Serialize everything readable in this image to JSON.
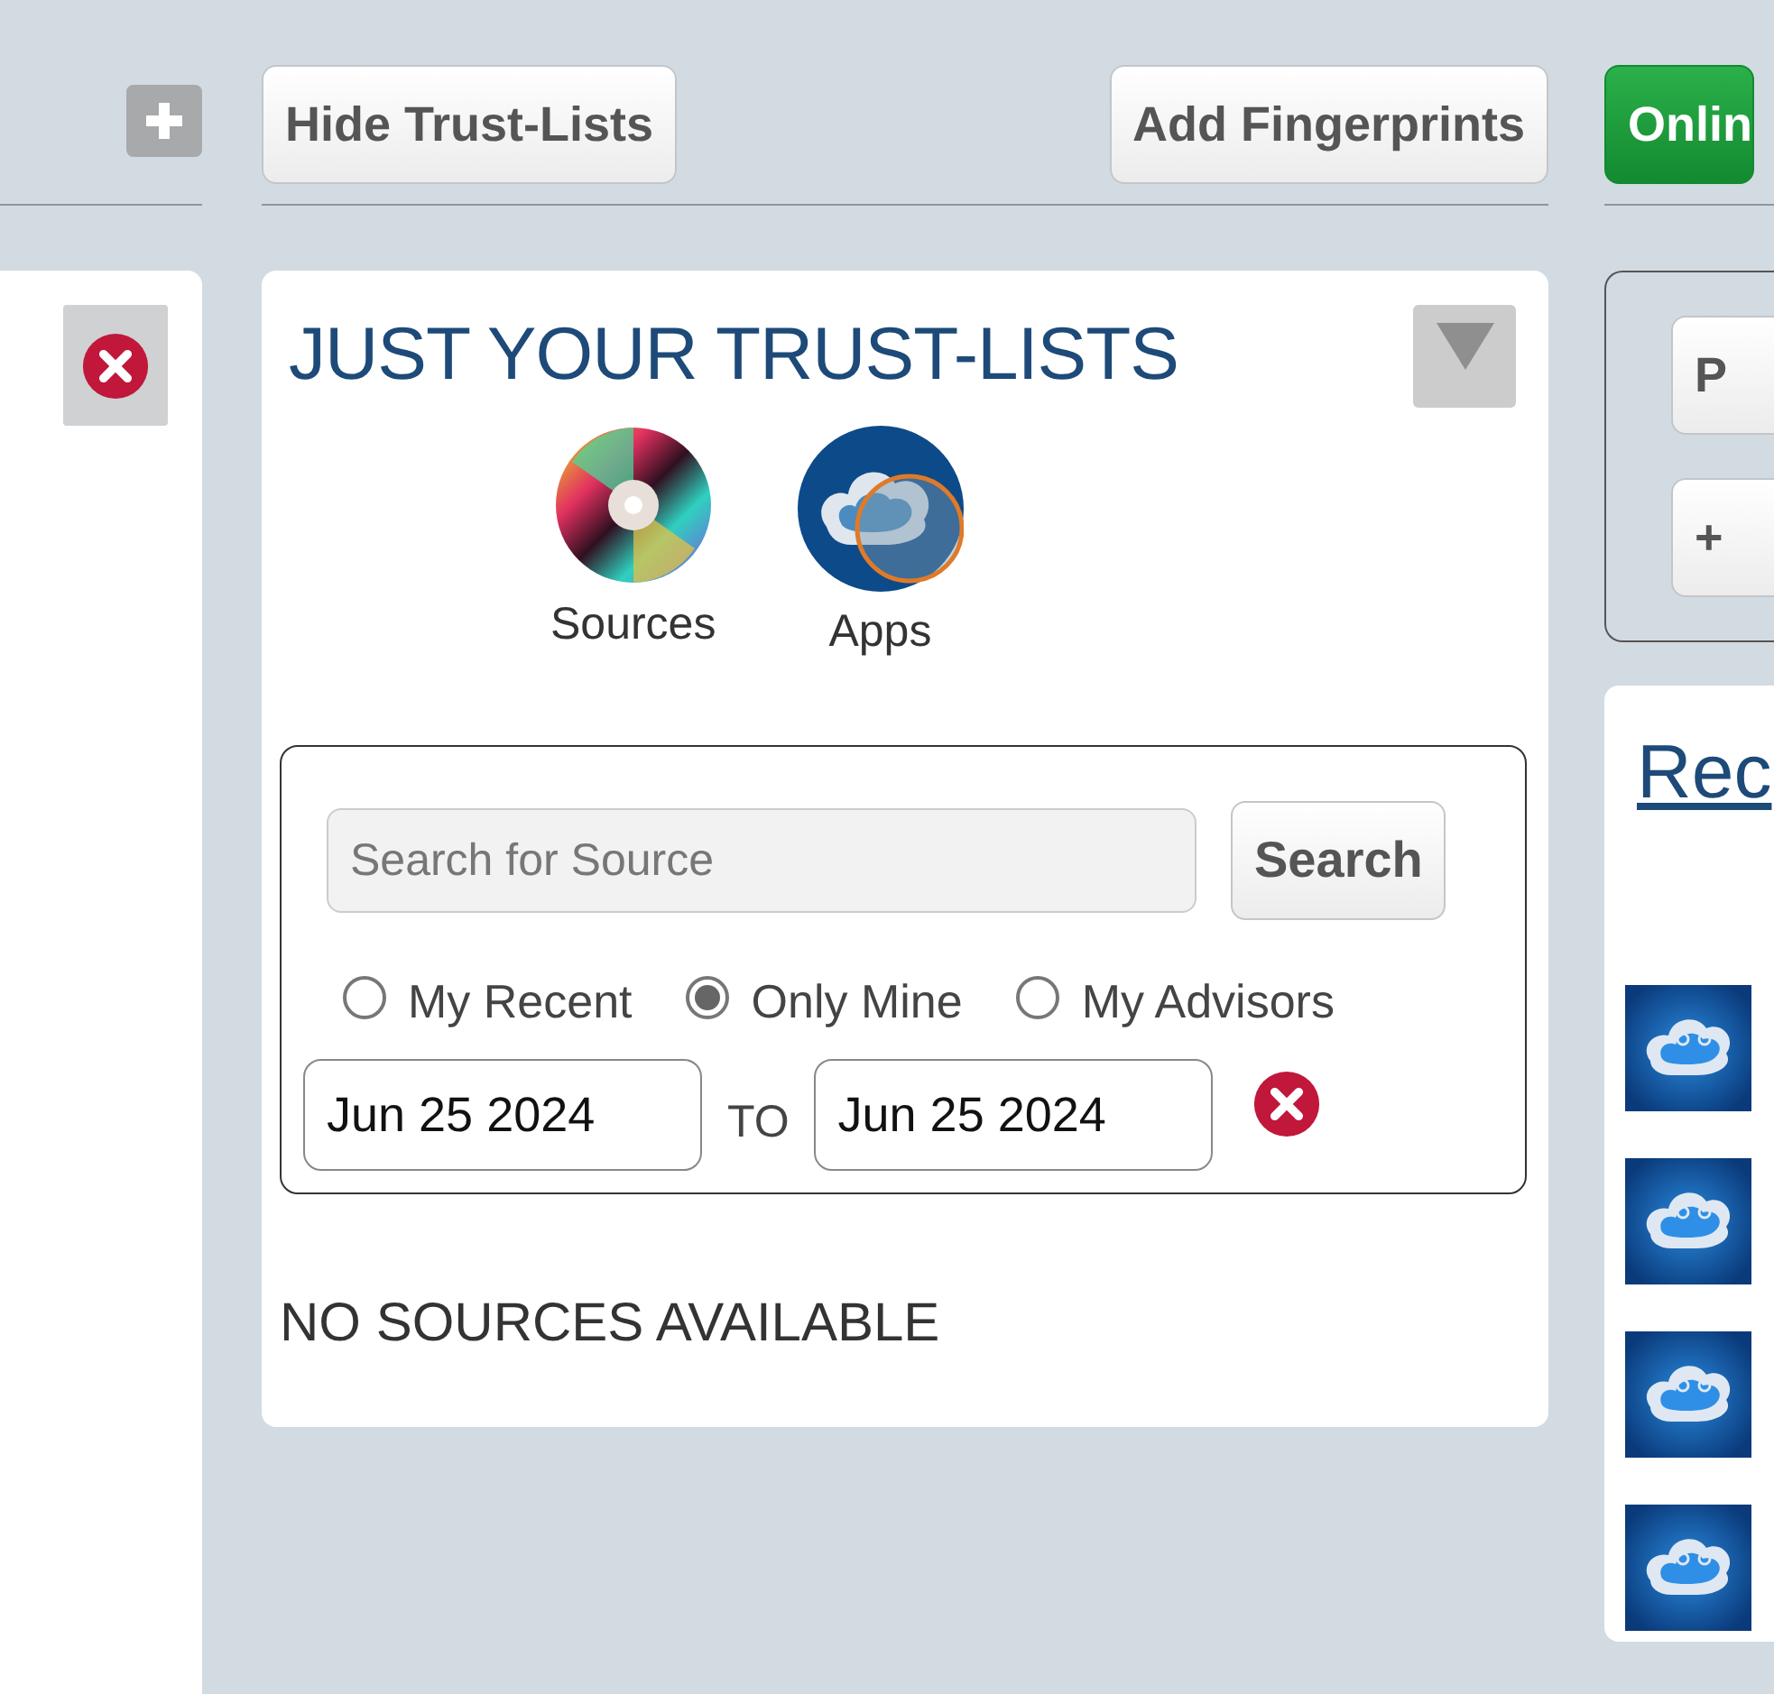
{
  "toolbar": {
    "buttons": [
      {
        "label": "Hide Trust-Lists",
        "kind": "default"
      },
      {
        "label": "Add Fingerprints",
        "kind": "default"
      },
      {
        "label": "Onlin",
        "kind": "success"
      }
    ]
  },
  "trust_lists": {
    "title": "JUST YOUR TRUST-LISTS",
    "categories": [
      {
        "label": "Sources",
        "kind": "disc"
      },
      {
        "label": "Apps",
        "kind": "cloud"
      }
    ],
    "search": {
      "placeholder": "Search for Source",
      "button": "Search",
      "filters": [
        {
          "label": "My Recent",
          "selected": false
        },
        {
          "label": "Only Mine",
          "selected": true
        },
        {
          "label": "My Advisors",
          "selected": false
        }
      ],
      "date_from": "Jun 25 2024",
      "separator": "TO",
      "date_to": "Jun 25 2024"
    },
    "empty_message": "NO SOURCES AVAILABLE"
  },
  "right_panel": {
    "buttons": [
      "P",
      "+"
    ],
    "recent_heading": "Rec",
    "recent_items": [
      {
        "kind": "app"
      },
      {
        "kind": "app"
      },
      {
        "kind": "app"
      },
      {
        "kind": "app"
      }
    ]
  }
}
